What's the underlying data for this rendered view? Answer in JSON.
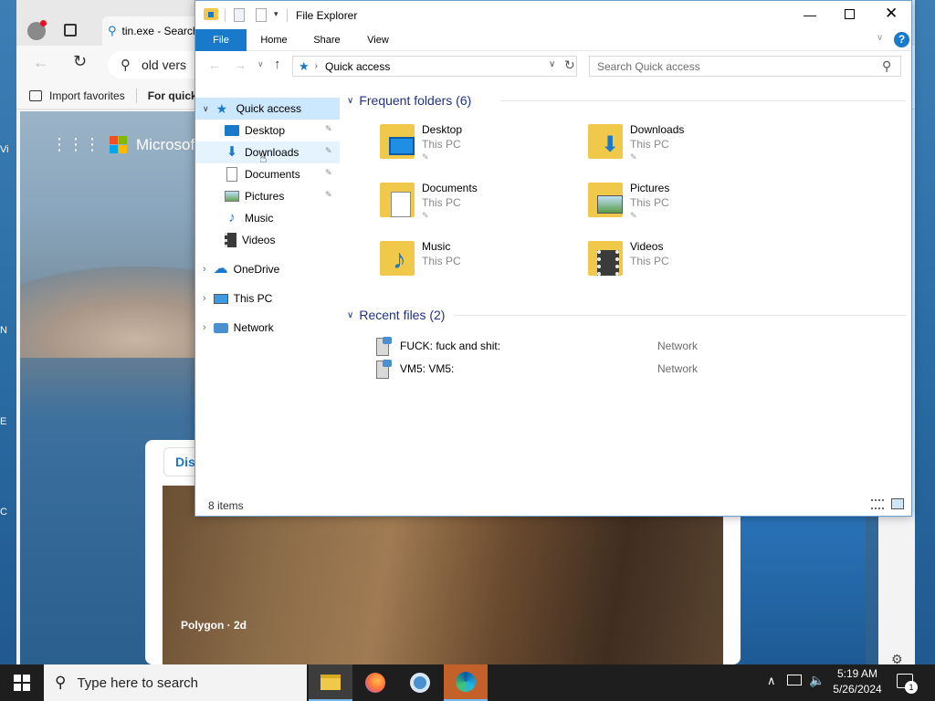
{
  "desktop": {
    "edge_labels": [
      "Vi",
      "N",
      "E",
      "C"
    ]
  },
  "browser": {
    "tab_title": "tin.exe - Search",
    "address_text": "old vers",
    "favorites": [
      "Import favorites",
      "For quick"
    ],
    "page": {
      "brand": "Microsoft Start",
      "tab_partial": "Disc",
      "photo_caption": "Polygon · 2d"
    }
  },
  "explorer": {
    "title": "File Explorer",
    "ribbon_tabs": [
      "File",
      "Home",
      "Share",
      "View"
    ],
    "address": {
      "location": "Quick access"
    },
    "search": {
      "placeholder": "Search Quick access"
    },
    "nav": {
      "quick_access": "Quick access",
      "pinned": [
        "Desktop",
        "Downloads",
        "Documents",
        "Pictures"
      ],
      "others": [
        "Music",
        "Videos"
      ],
      "onedrive": "OneDrive",
      "this_pc": "This PC",
      "network": "Network"
    },
    "frequent": {
      "header": "Frequent folders (6)",
      "items": [
        {
          "name": "Desktop",
          "location": "This PC",
          "pinned": true,
          "icon": "desktop-folder-icon"
        },
        {
          "name": "Downloads",
          "location": "This PC",
          "pinned": true,
          "icon": "downloads-folder-icon"
        },
        {
          "name": "Documents",
          "location": "This PC",
          "pinned": true,
          "icon": "documents-folder-icon"
        },
        {
          "name": "Pictures",
          "location": "This PC",
          "pinned": true,
          "icon": "pictures-folder-icon"
        },
        {
          "name": "Music",
          "location": "This PC",
          "pinned": false,
          "icon": "music-folder-icon"
        },
        {
          "name": "Videos",
          "location": "This PC",
          "pinned": false,
          "icon": "videos-folder-icon"
        }
      ]
    },
    "recent": {
      "header": "Recent files (2)",
      "items": [
        {
          "name": "FUCK: fuck and  shit:",
          "location": "Network"
        },
        {
          "name": "VM5: VM5:",
          "location": "Network"
        }
      ]
    },
    "status": {
      "count": "8 items"
    }
  },
  "taskbar": {
    "search_placeholder": "Type here to search",
    "time": "5:19 AM",
    "date": "5/26/2024",
    "notification_count": "1"
  },
  "colors": {
    "accent": "#1979ca",
    "selection": "#cce8ff",
    "group_header": "#1e3287",
    "taskbar": "#1e1e1e"
  }
}
